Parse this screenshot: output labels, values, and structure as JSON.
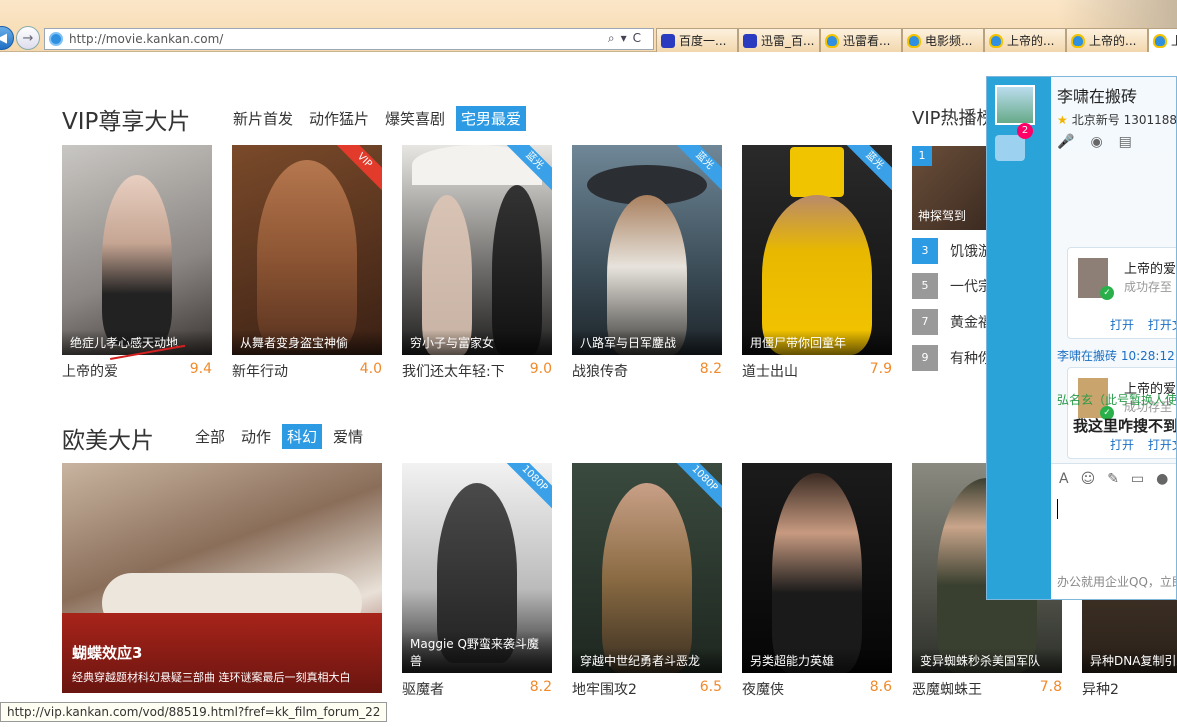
{
  "browser": {
    "url": "http://movie.kankan.com/",
    "tabs": [
      {
        "label": "百度一...",
        "icon": "baidu-paw-icon"
      },
      {
        "label": "迅雷_百...",
        "icon": "baidu-paw-icon"
      },
      {
        "label": "迅雷看...",
        "icon": "ie-shield-icon"
      },
      {
        "label": "电影频...",
        "icon": "ie-shield-icon"
      },
      {
        "label": "上帝的...",
        "icon": "ie-shield-icon"
      },
      {
        "label": "上帝的...",
        "icon": "ie-shield-icon"
      },
      {
        "label": "上帝",
        "icon": "ie-shield-icon"
      }
    ]
  },
  "vip": {
    "title": "VIP尊享大片",
    "tabs": [
      "新片首发",
      "动作猛片",
      "爆笑喜剧",
      "宅男最爱"
    ],
    "active_tab": "宅男最爱",
    "cards": [
      {
        "caption": "绝症儿孝心感天动地",
        "title": "上帝的爱",
        "score": "9.4",
        "badge": ""
      },
      {
        "caption": "从舞者变身盗宝神偷",
        "title": "新年行动",
        "score": "4.0",
        "badge": "VIP"
      },
      {
        "caption": "穷小子与富家女",
        "title": "我们还太年轻:下",
        "score": "9.0",
        "badge": "蓝光"
      },
      {
        "caption": "八路军与日军鏖战",
        "title": "战狼传奇",
        "score": "8.2",
        "badge": "蓝光"
      },
      {
        "caption": "用僵尸带你回童年",
        "title": "道士出山",
        "score": "7.9",
        "badge": "蓝光"
      }
    ]
  },
  "hot": {
    "title": "VIP热播榜",
    "top": {
      "rank": "1",
      "caption": "神探驾到"
    },
    "items": [
      {
        "rank": "3",
        "title": "饥饿游"
      },
      {
        "rank": "5",
        "title": "一代宗"
      },
      {
        "rank": "7",
        "title": "黄金福"
      },
      {
        "rank": "9",
        "title": "有种你"
      }
    ]
  },
  "western": {
    "title": "欧美大片",
    "tabs": [
      "全部",
      "动作",
      "科幻",
      "爱情"
    ],
    "active_tab": "科幻",
    "featured": {
      "caption_title": "蝴蝶效应3",
      "caption_sub": "经典穿越题材科幻悬疑三部曲 连环谜案最后一刻真相大白"
    },
    "cards": [
      {
        "caption": "Maggie Q野蛮来袭斗魔兽",
        "title": "驱魔者",
        "score": "8.2",
        "badge": "1080P"
      },
      {
        "caption": "穿越中世纪勇者斗恶龙",
        "title": "地牢围攻2",
        "score": "6.5",
        "badge": "1080P"
      },
      {
        "caption": "另类超能力英雄",
        "title": "夜魔侠",
        "score": "8.6",
        "badge": ""
      },
      {
        "caption": "变异蜘蛛秒杀美国军队",
        "title": "恶魔蜘蛛王",
        "score": "7.8",
        "badge": ""
      },
      {
        "caption": "异种DNA复制引发",
        "title": "异种2",
        "score": "",
        "badge": ""
      }
    ]
  },
  "qq": {
    "contact_name": "李啸在搬砖",
    "contact_sub": "北京新号 1301188",
    "badge": "2",
    "msg1": {
      "title": "上帝的爱",
      "status": "成功存至",
      "open": "打开",
      "open_folder": "打开文"
    },
    "sender2": "李啸在搬砖  10:28:12",
    "msg2": {
      "title": "上帝的爱",
      "status": "成功存至",
      "open": "打开",
      "open_folder": "打开文"
    },
    "sender3": "弘名玄（此号暂换人使",
    "msg3": "我这里咋搜不到",
    "footer": "办公就用企业QQ，立即"
  },
  "status_url": "http://vip.kankan.com/vod/88519.html?fref=kk_film_forum_22"
}
